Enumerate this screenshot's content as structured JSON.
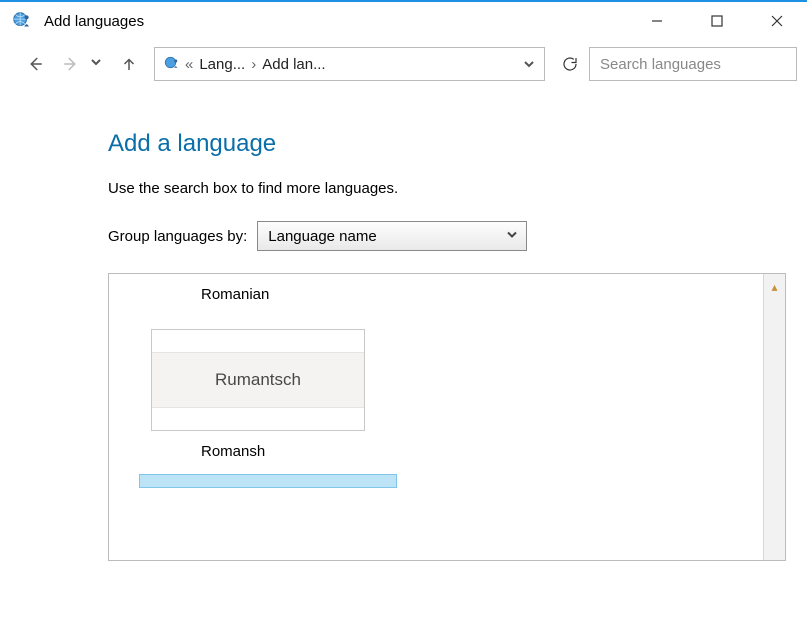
{
  "window": {
    "title": "Add languages"
  },
  "breadcrumbs": {
    "first": "Lang...",
    "second": "Add lan..."
  },
  "search": {
    "placeholder": "Search languages"
  },
  "content": {
    "heading": "Add a language",
    "instruction": "Use the search box to find more languages.",
    "group_label": "Group languages by:",
    "group_value": "Language name"
  },
  "languages": {
    "group_header": "Romanian",
    "tile_native": "Rumantsch",
    "tile_english": "Romansh"
  }
}
